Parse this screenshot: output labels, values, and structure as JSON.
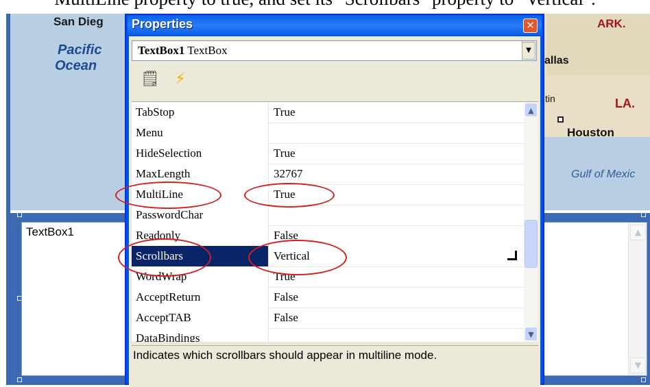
{
  "caption": "MultiLine property to true, and set its \"Scrollbars\" property to \"Vertical\".",
  "map": {
    "labels": {
      "san_diego": "San Dieg",
      "pacific_ocean_1": "Pacific",
      "pacific_ocean_2": "Ocean",
      "ark": "ARK.",
      "dallas": "allas",
      "austin": "tin",
      "la": "LA.",
      "houston": "Houston",
      "gulf": "Gulf of Mexic"
    }
  },
  "textbox": {
    "text": "TextBox1"
  },
  "properties_window": {
    "title": "Properties",
    "close_icon": "close-icon",
    "object_name": "TextBox1",
    "object_type": " TextBox",
    "toolbar": [
      {
        "icon": "property-pages-icon"
      },
      {
        "icon": "events-icon"
      }
    ],
    "rows": [
      {
        "name": "TabStop",
        "value": "True"
      },
      {
        "name": "Menu",
        "value": ""
      },
      {
        "name": "HideSelection",
        "value": "True"
      },
      {
        "name": "MaxLength",
        "value": "32767"
      },
      {
        "name": "MultiLine",
        "value": "True"
      },
      {
        "name": "PasswordChar",
        "value": ""
      },
      {
        "name": "Readonly",
        "value": "False"
      },
      {
        "name": "Scrollbars",
        "value": "Vertical",
        "selected": true
      },
      {
        "name": "WordWrap",
        "value": "True"
      },
      {
        "name": "AcceptReturn",
        "value": "False"
      },
      {
        "name": "AcceptTAB",
        "value": "False"
      },
      {
        "name": "DataBindings",
        "value": ""
      }
    ],
    "description": "Indicates which scrollbars should appear in multiline mode."
  },
  "colors": {
    "titlebar": "#0a5fe8",
    "selection": "#0a246a",
    "annotation": "#d41f1f",
    "form_border": "#3b69b3"
  }
}
